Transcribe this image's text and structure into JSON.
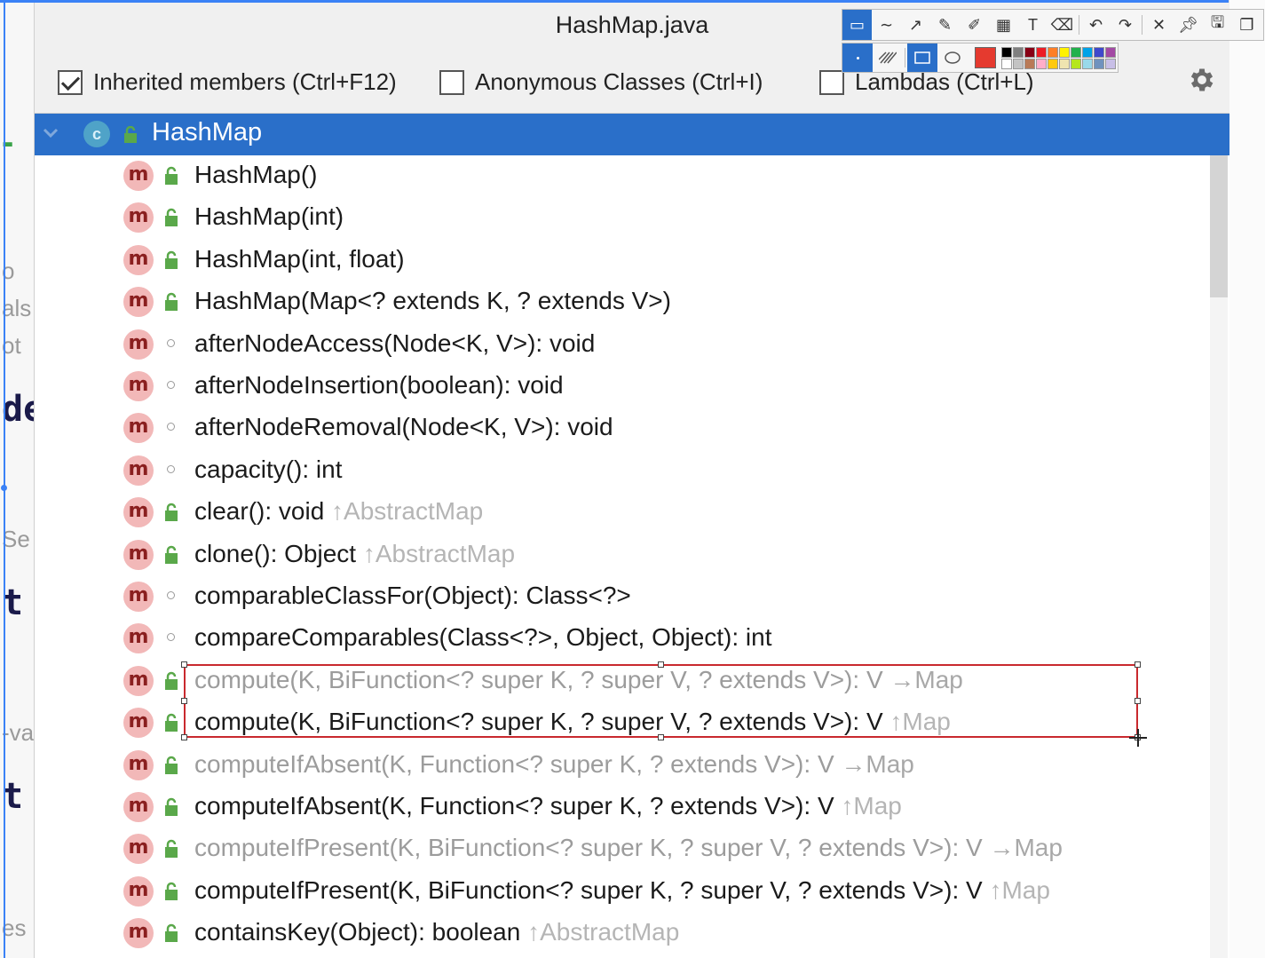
{
  "window": {
    "title": "HashMap.java"
  },
  "filters": [
    {
      "label": "Inherited members (Ctrl+F12)",
      "checked": true
    },
    {
      "label": "Anonymous Classes (Ctrl+I)",
      "checked": false
    },
    {
      "label": "Lambdas (Ctrl+L)",
      "checked": false
    }
  ],
  "settings_icon": "gear-icon",
  "tree": {
    "root": {
      "label": "HashMap",
      "icon": "class-icon",
      "expanded": true,
      "selected": true
    },
    "members": [
      {
        "text": "HashMap()",
        "owner": "",
        "visibility": "public",
        "dim": false
      },
      {
        "text": "HashMap(int)",
        "owner": "",
        "visibility": "public",
        "dim": false
      },
      {
        "text": "HashMap(int, float)",
        "owner": "",
        "visibility": "public",
        "dim": false
      },
      {
        "text": "HashMap(Map<? extends K, ? extends V>)",
        "owner": "",
        "visibility": "public",
        "dim": false
      },
      {
        "text": "afterNodeAccess(Node<K, V>): void",
        "owner": "",
        "visibility": "package",
        "dim": false
      },
      {
        "text": "afterNodeInsertion(boolean): void",
        "owner": "",
        "visibility": "package",
        "dim": false
      },
      {
        "text": "afterNodeRemoval(Node<K, V>): void",
        "owner": "",
        "visibility": "package",
        "dim": false
      },
      {
        "text": "capacity(): int",
        "owner": "",
        "visibility": "package",
        "dim": false
      },
      {
        "text": "clear(): void ",
        "owner": "↑AbstractMap",
        "visibility": "public",
        "dim": false
      },
      {
        "text": "clone(): Object ",
        "owner": "↑AbstractMap",
        "visibility": "public",
        "dim": false
      },
      {
        "text": "comparableClassFor(Object): Class<?>",
        "owner": "",
        "visibility": "package",
        "dim": false
      },
      {
        "text": "compareComparables(Class<?>, Object, Object): int",
        "owner": "",
        "visibility": "package",
        "dim": false
      },
      {
        "text": "compute(K, BiFunction<? super K, ? super V, ? extends V>): V ",
        "owner": "→Map",
        "visibility": "public",
        "dim": true
      },
      {
        "text": "compute(K, BiFunction<? super K, ? super V, ? extends V>): V ",
        "owner": "↑Map",
        "visibility": "public",
        "dim": false
      },
      {
        "text": "computeIfAbsent(K, Function<? super K, ? extends V>): V ",
        "owner": "→Map",
        "visibility": "public",
        "dim": true
      },
      {
        "text": "computeIfAbsent(K, Function<? super K, ? extends V>): V ",
        "owner": "↑Map",
        "visibility": "public",
        "dim": false
      },
      {
        "text": "computeIfPresent(K, BiFunction<? super K, ? super V, ? extends V>): V ",
        "owner": "→Map",
        "visibility": "public",
        "dim": true
      },
      {
        "text": "computeIfPresent(K, BiFunction<? super K, ? super V, ? extends V>): V ",
        "owner": "↑Map",
        "visibility": "public",
        "dim": false
      },
      {
        "text": "containsKey(Object): boolean ",
        "owner": "↑AbstractMap",
        "visibility": "public",
        "dim": false
      }
    ]
  },
  "editor_fragments": [
    "o",
    "als",
    "ot",
    "de",
    "Se",
    "t",
    "-va",
    "t",
    "es"
  ],
  "annotation_toolbar": {
    "tools": [
      "select-tool-icon",
      "curve-tool-icon",
      "arrow-tool-icon",
      "pen-tool-icon",
      "marker-tool-icon",
      "mosaic-tool-icon",
      "text-tool-icon",
      "eraser-tool-icon",
      "undo-icon",
      "redo-icon",
      "close-icon",
      "pin-icon",
      "save-icon",
      "copy-icon"
    ],
    "current_color": "#e53a2f",
    "palette": [
      "#000000",
      "#7f7f7f",
      "#880015",
      "#ed1c24",
      "#ff7f27",
      "#fff200",
      "#22b14c",
      "#00a2e8",
      "#3f48cc",
      "#a349a4",
      "#ffffff",
      "#c3c3c3",
      "#b97a57",
      "#ffaec9",
      "#ffc90e",
      "#efe4b0",
      "#b5e61d",
      "#99d9ea",
      "#7092be",
      "#c8bfe7"
    ]
  },
  "colors": {
    "selection": "#2a6fc9",
    "method_icon_bg": "#f2b8b8",
    "method_icon_fg": "#8a1f1f",
    "public_icon": "#5aa84a",
    "annotation_rect": "#c9292e"
  }
}
